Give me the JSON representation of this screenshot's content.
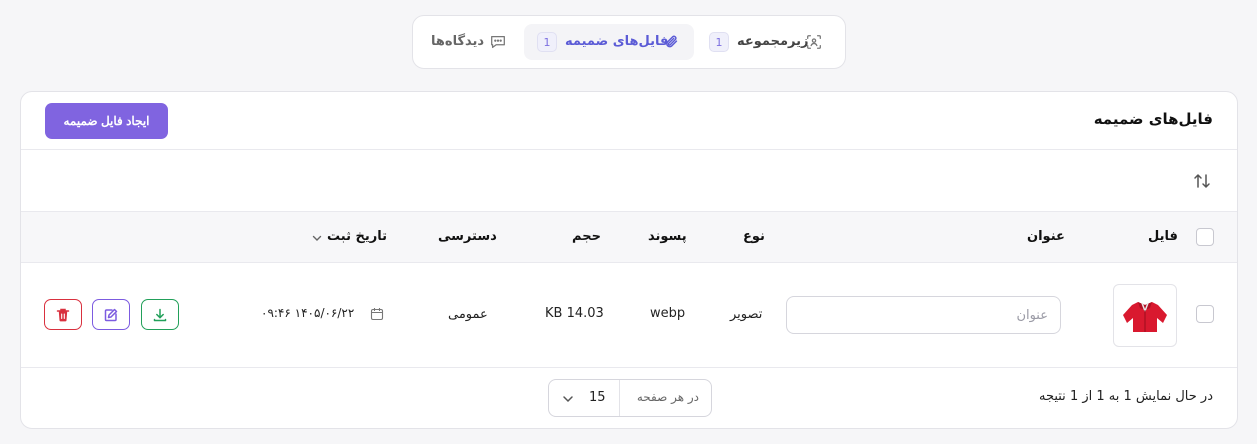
{
  "tabs": {
    "subcategory": {
      "label": "زیرمجموعه",
      "count": "1",
      "icon": "focus-icon"
    },
    "attachments": {
      "label": "فایل‌های ضمیمه",
      "count": "1",
      "icon": "paperclip-icon"
    },
    "comments": {
      "label": "دیدگاه‌ها",
      "icon": "comment-icon"
    }
  },
  "card": {
    "title": "فایل‌های ضمیمه",
    "create_button": "ایجاد فایل ضمیمه"
  },
  "table": {
    "headers": {
      "file": "فایل",
      "title": "عنوان",
      "type": "نوع",
      "extension": "پسوند",
      "size": "حجم",
      "access": "دسترسی",
      "created": "تاریخ ثبت"
    },
    "rows": [
      {
        "title_value": "",
        "title_placeholder": "عنوان",
        "type": "تصویر",
        "extension": "webp",
        "size": "KB 14.03",
        "access": "عمومی",
        "created": "۱۴۰۵/۰۶/۲۲ ۰۹:۴۶"
      }
    ]
  },
  "footer": {
    "summary": "در حال نمایش 1 به 1 از 1 نتیجه",
    "per_page_label": "در هر صفحه",
    "per_page_value": "15"
  },
  "colors": {
    "accent": "#8064e0",
    "download": "#22a05a",
    "edit": "#7c5be0",
    "delete": "#d9303e"
  }
}
